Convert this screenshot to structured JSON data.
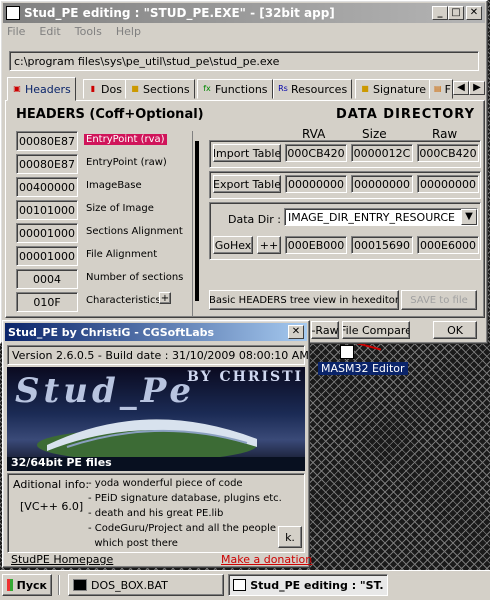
{
  "main_window": {
    "title": "Stud_PE editing : \"STUD_PE.EXE\" - [32bit app]",
    "menu": [
      "File",
      "Edit",
      "Tools",
      "Help"
    ],
    "path": "c:\\program files\\sys\\pe_util\\stud_pe\\stud_pe.exe",
    "tabs": [
      {
        "label": "Headers",
        "icon": "headers-icon"
      },
      {
        "label": "Dos",
        "icon": "dos-icon"
      },
      {
        "label": "Sections",
        "icon": "sections-icon"
      },
      {
        "label": "Functions",
        "icon": "functions-icon"
      },
      {
        "label": "Resources",
        "icon": "resources-icon"
      },
      {
        "label": "Signature",
        "icon": "signature-icon"
      },
      {
        "label": "F",
        "icon": "folder-icon"
      }
    ],
    "headers_title": "HEADERS (Coff+Optional)",
    "header_fields": [
      {
        "value": "00080E87",
        "label": "EntryPoint (rva)"
      },
      {
        "value": "00080E87",
        "label": "EntryPoint (raw)"
      },
      {
        "value": "00400000",
        "label": "ImageBase"
      },
      {
        "value": "00101000",
        "label": "Size of Image"
      },
      {
        "value": "00001000",
        "label": "Sections Alignment"
      },
      {
        "value": "00001000",
        "label": "File Alignment"
      },
      {
        "value": "0004",
        "label": "Number of sections"
      },
      {
        "value": "010F",
        "label": "Characteristics"
      }
    ],
    "plus_label": "+",
    "data_directory": {
      "title": "DATA DIRECTORY",
      "col_rva": "RVA",
      "col_size": "Size",
      "col_raw": "Raw",
      "import_table": {
        "label": "Import Table",
        "rva": "000CB420",
        "size": "0000012C",
        "raw": "000CB420"
      },
      "export_table": {
        "label": "Export Table",
        "rva": "00000000",
        "size": "00000000",
        "raw": "00000000"
      },
      "data_dir_label": "Data Dir :",
      "data_dir_value": "IMAGE_DIR_ENTRY_RESOURCE",
      "gohex_label": "GoHex",
      "plusplus_label": "++",
      "dir_values": {
        "rva": "000EB000",
        "size": "00015690",
        "raw": "000E6000"
      }
    },
    "basic_headers_label": "Basic HEADERS tree view in hexeditor",
    "save_label": "SAVE to file",
    "raw_label": "-Raw",
    "file_compare_label": "File Compare",
    "ok_label": "OK"
  },
  "about_window": {
    "title": "Stud_PE by ChristiG - CGSoftLabs",
    "version": "Version 2.6.0.5 - Build date : 31/10/2009 08:00:10 AM",
    "logo_text": "Stud_Pe",
    "logo_by": "BY CHRISTI G",
    "files_caption": "32/64bit PE files",
    "info_label": "Aditional info:",
    "compiler": "[VC++ 6.0]",
    "info_lines": [
      "- yoda wonderful piece of code",
      "- PEiD signature database, plugins etc.",
      "- death and his great PE.lib",
      "- CodeGuru/Project and all the people",
      "  which post there"
    ],
    "ok_label": "k.",
    "homepage_label": "StudPE Homepage",
    "donation_label": "Make a donation"
  },
  "desktop_icon": {
    "label": "MASM32 Editor"
  },
  "taskbar": {
    "start_label": "Пуск",
    "items": [
      {
        "label": "DOS_BOX.BAT"
      },
      {
        "label": "Stud_PE editing : \"ST..."
      }
    ]
  }
}
